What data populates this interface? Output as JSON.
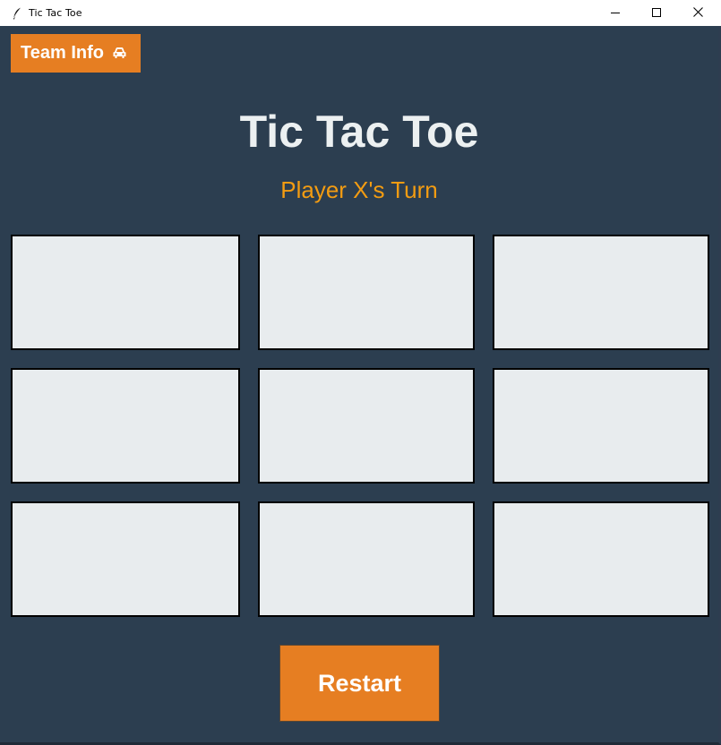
{
  "window": {
    "title": "Tic Tac Toe",
    "app_icon": "feather-icon",
    "controls": [
      "minimize-icon",
      "maximize-icon",
      "close-icon"
    ]
  },
  "toolbar": {
    "team_info_label": "Team Info",
    "team_info_icon": "car-icon"
  },
  "game": {
    "heading": "Tic Tac Toe",
    "status": "Player X's Turn",
    "cells": [
      "",
      "",
      "",
      "",
      "",
      "",
      "",
      "",
      ""
    ],
    "restart_label": "Restart"
  },
  "colors": {
    "background": "#2c3e50",
    "accent": "#e67e22",
    "status_text": "#f39c12",
    "heading_text": "#ecf0f1",
    "cell_fill": "#e8ecee",
    "cell_border": "#000000"
  }
}
